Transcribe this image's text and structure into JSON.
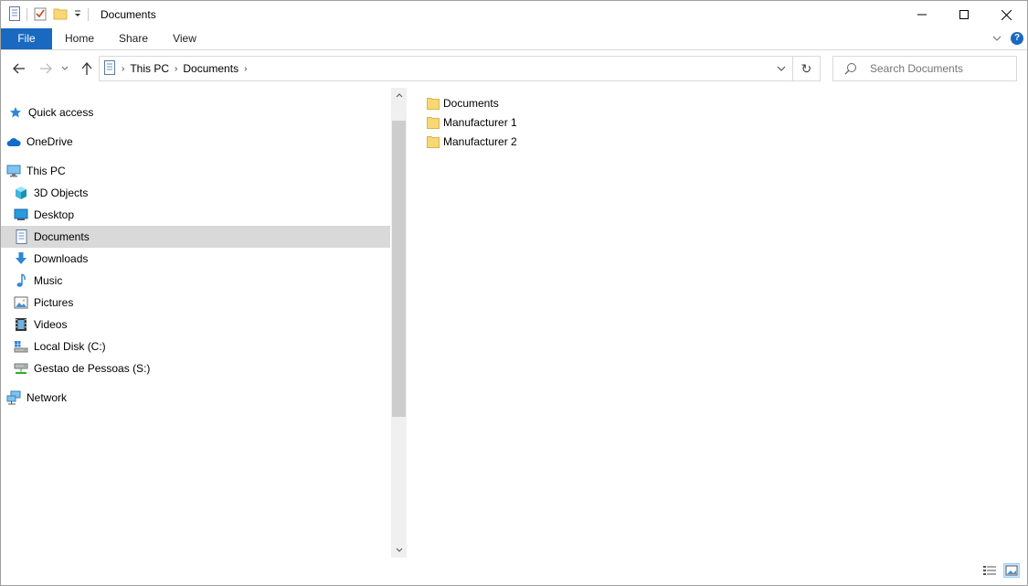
{
  "window": {
    "title": "Documents"
  },
  "ribbon": {
    "tabs": [
      {
        "label": "File"
      },
      {
        "label": "Home"
      },
      {
        "label": "Share"
      },
      {
        "label": "View"
      }
    ]
  },
  "address": {
    "crumbs": [
      "This PC",
      "Documents"
    ]
  },
  "search": {
    "placeholder": "Search Documents"
  },
  "sidebar": {
    "items": [
      {
        "label": "Quick access",
        "icon": "star-icon"
      },
      {
        "label": "OneDrive",
        "icon": "cloud-icon"
      },
      {
        "label": "This PC",
        "icon": "monitor-icon"
      },
      {
        "label": "3D Objects",
        "icon": "cube-icon"
      },
      {
        "label": "Desktop",
        "icon": "desktop-icon"
      },
      {
        "label": "Documents",
        "icon": "document-icon",
        "selected": true
      },
      {
        "label": "Downloads",
        "icon": "download-icon"
      },
      {
        "label": "Music",
        "icon": "music-icon"
      },
      {
        "label": "Pictures",
        "icon": "pictures-icon"
      },
      {
        "label": "Videos",
        "icon": "video-icon"
      },
      {
        "label": "Local Disk (C:)",
        "icon": "disk-icon"
      },
      {
        "label": "Gestao de Pessoas (S:)",
        "icon": "network-drive-icon"
      },
      {
        "label": "Network",
        "icon": "network-icon"
      }
    ]
  },
  "files": [
    {
      "name": "Documents",
      "icon": "folder-icon"
    },
    {
      "name": "Manufacturer 1",
      "icon": "folder-icon"
    },
    {
      "name": "Manufacturer 2",
      "icon": "folder-icon"
    }
  ],
  "colors": {
    "accent": "#1969c1",
    "selected": "#d9d9d9",
    "folder": "#f8d775"
  }
}
